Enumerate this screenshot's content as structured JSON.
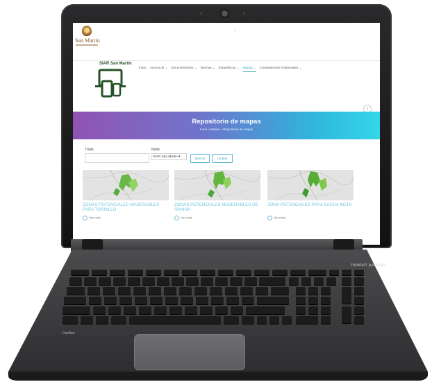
{
  "site": {
    "logo_text": "San Martin",
    "siar_title": "SIAR San Martin",
    "nav": [
      {
        "label": "Inicio",
        "active": false
      },
      {
        "label": "Acerca de ⌄",
        "active": false
      },
      {
        "label": "Documentación ⌄",
        "active": false
      },
      {
        "label": "Normas ⌄",
        "active": false
      },
      {
        "label": "Estadísticas ⌄",
        "active": false
      },
      {
        "label": "Mapas ⌄",
        "active": true
      },
      {
        "label": "Competencias Ambientales ⌄",
        "active": false
      }
    ],
    "search_icon": "search-icon"
  },
  "banner": {
    "title": "Repositorio de mapas",
    "breadcrumb": "Inicio  »  Mapas  »  Repositorio de mapas",
    "gradient_from": "#8e4fb0",
    "gradient_to": "#35d6e8"
  },
  "filters": {
    "title_label": "Título",
    "title_value": "",
    "node_label": "Nodo",
    "node_value": "SIAR San Martin ▾",
    "search_button": "Buscar",
    "clear_button": "Limpiar"
  },
  "cards": [
    {
      "title": "ZONAS POTENCIALES MADERABLES PARA TORNILLO",
      "link": "Ver más"
    },
    {
      "title": "ZONAS POTENCIALES MADERABLES DE SHAINA",
      "link": "Ver más"
    },
    {
      "title": "ZONA POTENCIALES PARA SACHA INCHI",
      "link": "Ver más"
    }
  ],
  "device": {
    "brand": "hewlett packard",
    "model": "Pavilion"
  },
  "colors": {
    "accent": "#3aa6b9",
    "card_title": "#6ec6e2",
    "siar_green": "#1f4e23"
  }
}
